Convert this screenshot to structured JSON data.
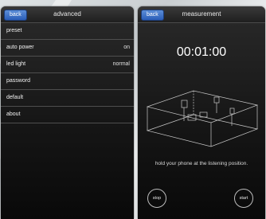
{
  "left_screen": {
    "back_label": "back",
    "title": "advanced",
    "items": [
      {
        "label": "preset",
        "value": ""
      },
      {
        "label": "auto power",
        "value": "on"
      },
      {
        "label": "led light",
        "value": "normal"
      },
      {
        "label": "password",
        "value": ""
      },
      {
        "label": "default",
        "value": ""
      },
      {
        "label": "about",
        "value": ""
      }
    ]
  },
  "right_screen": {
    "back_label": "back",
    "title": "measurement",
    "timer": "00:01:00",
    "instruction": "hold your phone at the listening position.",
    "stop_label": "stop",
    "start_label": "start"
  }
}
